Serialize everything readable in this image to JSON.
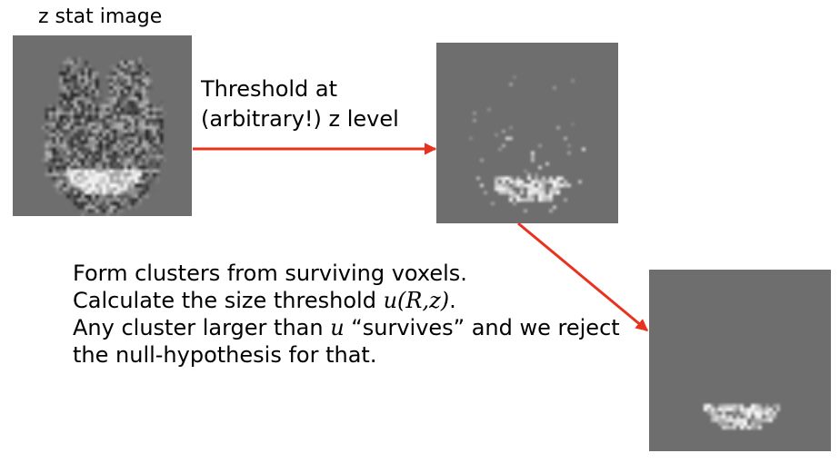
{
  "panels": {
    "zstat_caption": "z stat image",
    "threshold_caption_line1": "Threshold at",
    "threshold_caption_line2": "(arbitrary!) z level"
  },
  "explanation": {
    "line1": "Form clusters from surviving voxels.",
    "line2_prefix": "Calculate the size threshold ",
    "line2_math": "u(R,z)",
    "line2_suffix": ".",
    "line3_prefix": "Any cluster larger than ",
    "line3_math": "u",
    "line3_suffix": " “survives” and we reject",
    "line4": "the null-hypothesis for that."
  },
  "colors": {
    "arrow": "#e8321e",
    "panel_background": "#6e6e6e"
  },
  "icons": [
    "brain-zstat-image",
    "brain-thresholded-image",
    "brain-cluster-image",
    "arrow-right",
    "arrow-down-right"
  ]
}
